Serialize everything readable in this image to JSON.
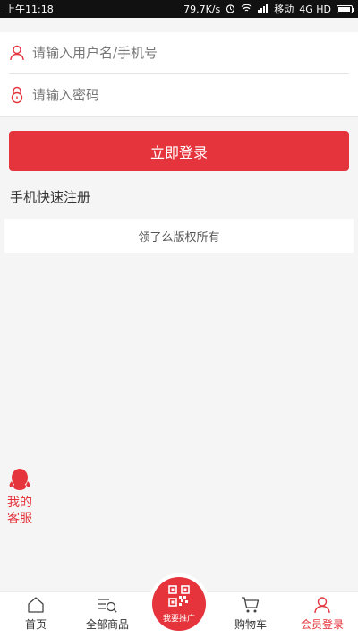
{
  "status_bar": {
    "time": "上午11:18",
    "speed": "79.7K/s",
    "carrier": "移动",
    "network": "4G HD",
    "icons": [
      "alarm-icon",
      "wifi-icon",
      "signal-icon",
      "battery-icon"
    ]
  },
  "form": {
    "username_placeholder": "请输入用户名/手机号",
    "password_placeholder": "请输入密码",
    "login_label": "立即登录",
    "register_label": "手机快速注册"
  },
  "footer": {
    "copyright": "领了么版权所有"
  },
  "service": {
    "label": "我的客服",
    "icon": "penguin-icon"
  },
  "nav": {
    "tabs": [
      {
        "label": "首页",
        "icon": "home-icon"
      },
      {
        "label": "全部商品",
        "icon": "category-search-icon"
      },
      {
        "label": "我要推广",
        "icon": "qrcode-icon"
      },
      {
        "label": "购物车",
        "icon": "cart-icon"
      },
      {
        "label": "会员登录",
        "icon": "user-icon"
      }
    ],
    "active": "会员登录"
  },
  "colors": {
    "accent": "#e5343c",
    "background": "#f5f5f5"
  }
}
